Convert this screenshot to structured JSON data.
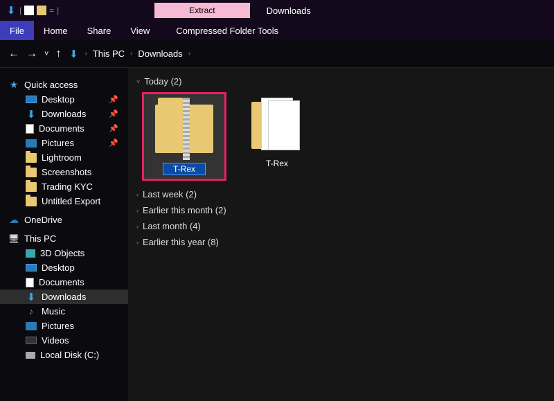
{
  "titlebar": {
    "extract_tab": "Extract",
    "window_title": "Downloads"
  },
  "menu": {
    "file": "File",
    "home": "Home",
    "share": "Share",
    "view": "View",
    "context": "Compressed Folder Tools"
  },
  "nav": {
    "breadcrumb": {
      "root_icon": "download-icon",
      "seg1": "This PC",
      "seg2": "Downloads"
    }
  },
  "sidebar": {
    "quick_access": "Quick access",
    "qa_items": [
      {
        "label": "Desktop",
        "pinned": true
      },
      {
        "label": "Downloads",
        "pinned": true
      },
      {
        "label": "Documents",
        "pinned": true
      },
      {
        "label": "Pictures",
        "pinned": true
      },
      {
        "label": "Lightroom",
        "pinned": false
      },
      {
        "label": "Screenshots",
        "pinned": false
      },
      {
        "label": "Trading KYC",
        "pinned": false
      },
      {
        "label": "Untitled Export",
        "pinned": false
      }
    ],
    "onedrive": "OneDrive",
    "this_pc": "This PC",
    "pc_items": [
      {
        "label": "3D Objects"
      },
      {
        "label": "Desktop"
      },
      {
        "label": "Documents"
      },
      {
        "label": "Downloads",
        "selected": true
      },
      {
        "label": "Music"
      },
      {
        "label": "Pictures"
      },
      {
        "label": "Videos"
      },
      {
        "label": "Local Disk (C:)"
      }
    ]
  },
  "content": {
    "groups": [
      {
        "label": "Today",
        "count": 2,
        "expanded": true
      },
      {
        "label": "Last week",
        "count": 2,
        "expanded": false
      },
      {
        "label": "Earlier this month",
        "count": 2,
        "expanded": false
      },
      {
        "label": "Last month",
        "count": 4,
        "expanded": false
      },
      {
        "label": "Earlier this year",
        "count": 8,
        "expanded": false
      }
    ],
    "today_items": [
      {
        "label": "T-Rex",
        "type": "zip",
        "selected": true,
        "editing": true
      },
      {
        "label": "T-Rex",
        "type": "folder-open",
        "selected": false
      }
    ]
  }
}
